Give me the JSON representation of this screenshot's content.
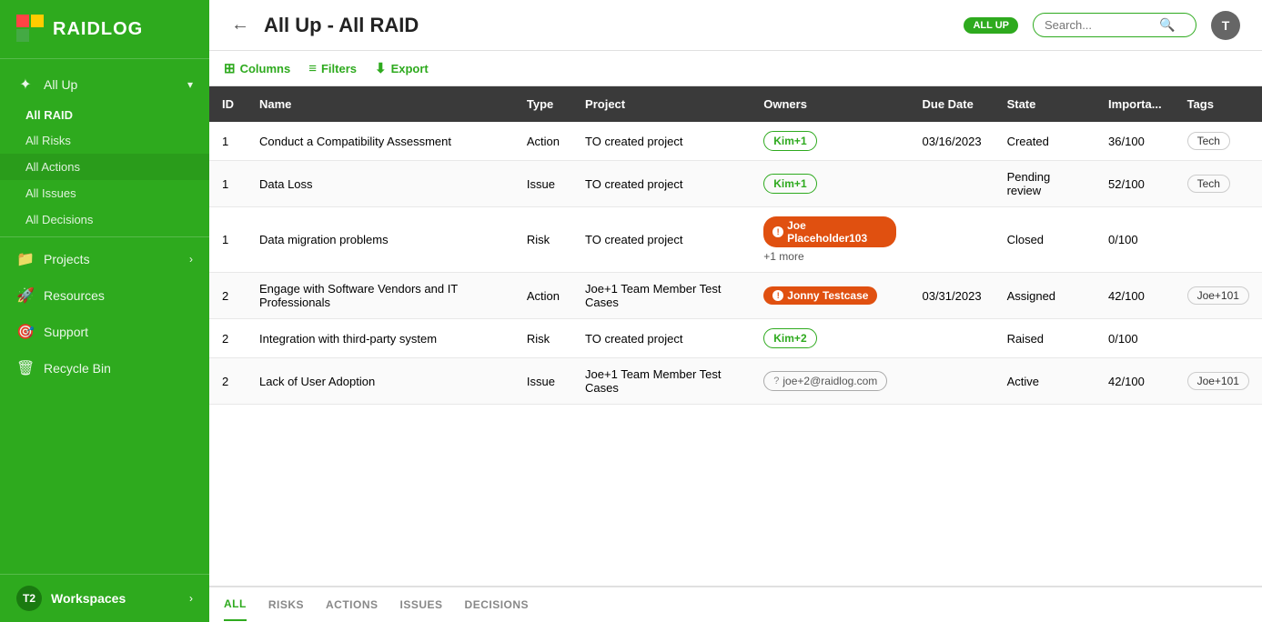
{
  "sidebar": {
    "logo_text": "RAIDLOG",
    "allup_label": "All Up",
    "allraid_label": "All RAID",
    "subitems": [
      {
        "label": "All Risks",
        "key": "all-risks"
      },
      {
        "label": "All Actions",
        "key": "all-actions"
      },
      {
        "label": "All Issues",
        "key": "all-issues"
      },
      {
        "label": "All Decisions",
        "key": "all-decisions"
      }
    ],
    "nav_items": [
      {
        "label": "Projects",
        "icon": "📁",
        "has_arrow": true
      },
      {
        "label": "Resources",
        "icon": "🚀",
        "has_arrow": false
      },
      {
        "label": "Support",
        "icon": "🎯",
        "has_arrow": false
      },
      {
        "label": "Recycle Bin",
        "icon": "🗑",
        "has_arrow": false
      }
    ],
    "workspace_badge": "T2",
    "workspace_label": "Workspaces"
  },
  "header": {
    "back_icon": "←",
    "title": "All Up - All RAID",
    "allup_badge": "ALL UP",
    "search_placeholder": "Search...",
    "user_initial": "T"
  },
  "toolbar": {
    "columns_label": "Columns",
    "filters_label": "Filters",
    "export_label": "Export"
  },
  "table": {
    "columns": [
      "ID",
      "Name",
      "Type",
      "Project",
      "Owners",
      "Due Date",
      "State",
      "Importa...",
      "Tags"
    ],
    "rows": [
      {
        "id": "1",
        "name": "Conduct a Compatibility Assessment",
        "type": "Action",
        "project": "TO created project",
        "owner_badge_type": "green",
        "owner_label": "Kim+1",
        "due_date": "03/16/2023",
        "state": "Created",
        "importance": "36/100",
        "tag": "Tech"
      },
      {
        "id": "1",
        "name": "Data Loss",
        "type": "Issue",
        "project": "TO created project",
        "owner_badge_type": "green",
        "owner_label": "Kim+1",
        "due_date": "",
        "state": "Pending review",
        "importance": "52/100",
        "tag": "Tech"
      },
      {
        "id": "1",
        "name": "Data migration problems",
        "type": "Risk",
        "project": "TO created project",
        "owner_badge_type": "alert",
        "owner_label": "Joe Placeholder103",
        "owner_more": "+1 more",
        "due_date": "",
        "state": "Closed",
        "importance": "0/100",
        "tag": ""
      },
      {
        "id": "2",
        "name": "Engage with Software Vendors and IT Professionals",
        "type": "Action",
        "project": "Joe+1 Team Member Test Cases",
        "owner_badge_type": "alert",
        "owner_label": "Jonny Testcase",
        "due_date": "03/31/2023",
        "state": "Assigned",
        "importance": "42/100",
        "tag": "Joe+101"
      },
      {
        "id": "2",
        "name": "Integration with third-party system",
        "type": "Risk",
        "project": "TO created project",
        "owner_badge_type": "green",
        "owner_label": "Kim+2",
        "due_date": "",
        "state": "Raised",
        "importance": "0/100",
        "tag": ""
      },
      {
        "id": "2",
        "name": "Lack of User Adoption",
        "type": "Issue",
        "project": "Joe+1 Team Member Test Cases",
        "owner_badge_type": "gray",
        "owner_label": "joe+2@raidlog.com",
        "due_date": "",
        "state": "Active",
        "importance": "42/100",
        "tag": "Joe+101"
      }
    ]
  },
  "bottom_tabs": [
    {
      "label": "ALL",
      "active": true
    },
    {
      "label": "RISKS",
      "active": false
    },
    {
      "label": "ACTIONS",
      "active": false
    },
    {
      "label": "ISSUES",
      "active": false
    },
    {
      "label": "DECISIONS",
      "active": false
    }
  ]
}
